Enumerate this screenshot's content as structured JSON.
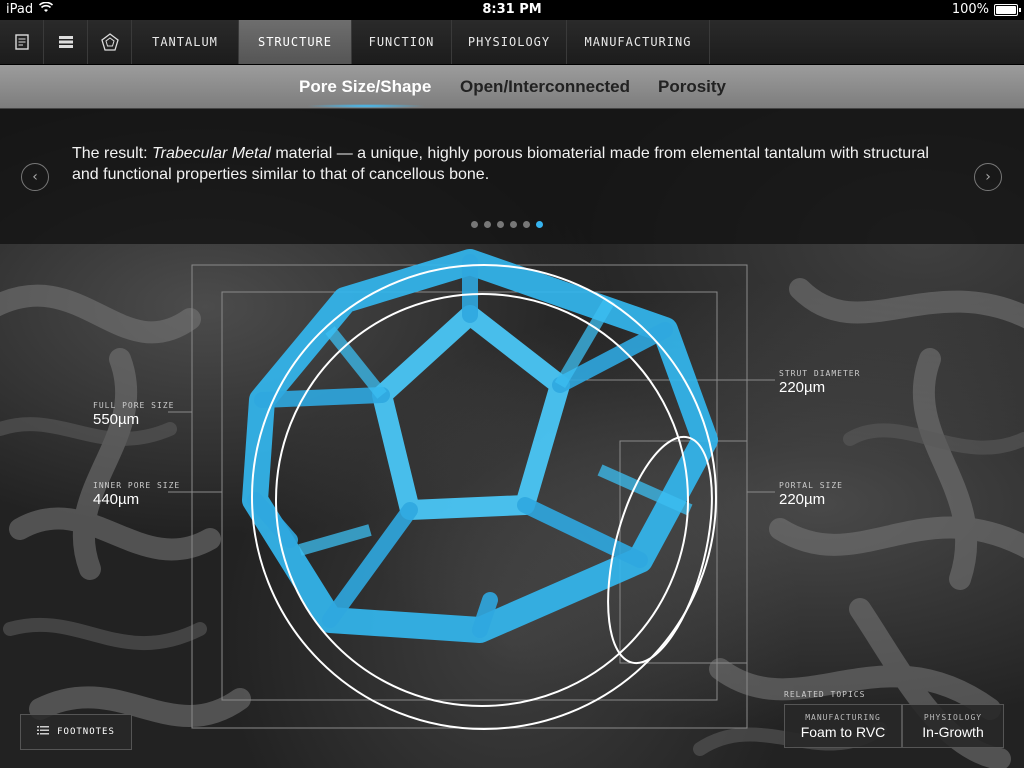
{
  "status_bar": {
    "device": "iPad",
    "time": "8:31 PM",
    "battery": "100%",
    "battery_level": 1.0
  },
  "top_nav": {
    "icons": [
      "document-icon",
      "stack-icon",
      "dodecahedron-icon"
    ],
    "tabs": [
      {
        "label": "TANTALUM",
        "active": false
      },
      {
        "label": "STRUCTURE",
        "active": true
      },
      {
        "label": "FUNCTION",
        "active": false
      },
      {
        "label": "PHYSIOLOGY",
        "active": false
      },
      {
        "label": "MANUFACTURING",
        "active": false
      }
    ]
  },
  "sub_nav": {
    "tabs": [
      {
        "label": "Pore Size/Shape",
        "active": true
      },
      {
        "label": "Open/Interconnected",
        "active": false
      },
      {
        "label": "Porosity",
        "active": false
      }
    ]
  },
  "caption": {
    "prefix": "The result: ",
    "emphasis": "Trabecular Metal",
    "suffix": " material — a unique, highly porous biomaterial made from elemental tantalum with structural and functional properties similar to that of cancellous bone."
  },
  "pager": {
    "count": 6,
    "active_index": 5
  },
  "annotations": {
    "full_pore": {
      "caption": "FULL PORE SIZE",
      "value": "550µm"
    },
    "inner_pore": {
      "caption": "INNER PORE SIZE",
      "value": "440µm"
    },
    "strut": {
      "caption": "STRUT DIAMETER",
      "value": "220µm"
    },
    "portal": {
      "caption": "PORTAL SIZE",
      "value": "220µm"
    }
  },
  "footnotes": {
    "label": "FOOTNOTES"
  },
  "related": {
    "title": "RELATED TOPICS",
    "items": [
      {
        "caption": "MANUFACTURING",
        "value": "Foam to RVC"
      },
      {
        "caption": "PHYSIOLOGY",
        "value": "In-Growth"
      }
    ]
  },
  "colors": {
    "accent": "#36b4f0",
    "model": "#38b9ee"
  }
}
